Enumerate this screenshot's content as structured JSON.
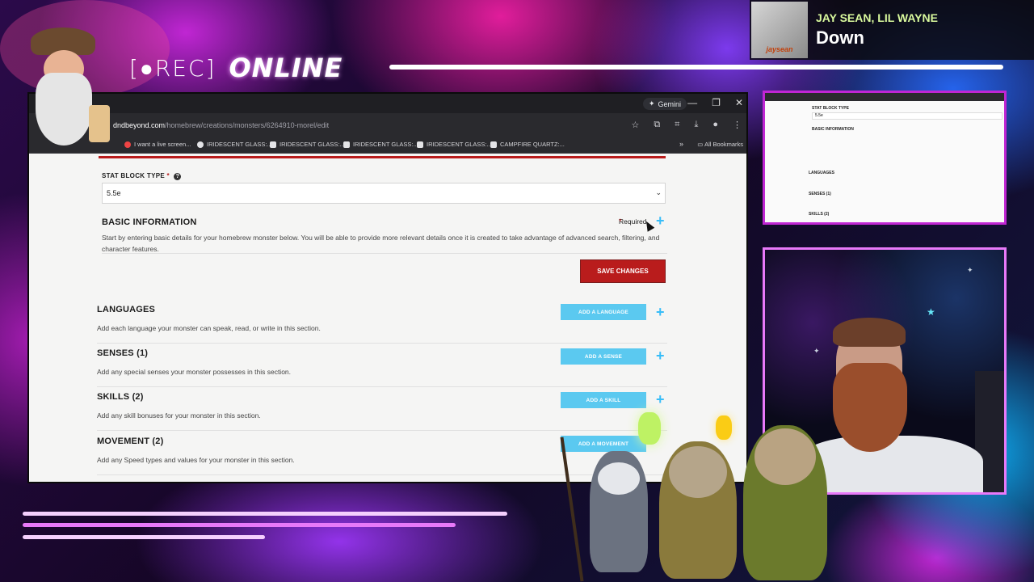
{
  "overlay": {
    "rec_label": "[●REC]",
    "online_label": "ONLINE",
    "colors": {
      "accent_pink": "#e879f9",
      "accent_blue": "#38bdf8"
    }
  },
  "now_playing": {
    "artist": "JAY SEAN, LIL WAYNE",
    "title": "Down",
    "album_text": "jaysean"
  },
  "browser": {
    "gemini_label": "Gemini",
    "url_host": "dndbeyond.com",
    "url_path": "/homebrew/creations/monsters/6264910-morel/edit",
    "bookmarks": [
      "I want a live screen...",
      "IRIDESCENT GLASS:...",
      "IRIDESCENT GLASS:...",
      "IRIDESCENT GLASS:...",
      "IRIDESCENT GLASS:...",
      "CAMPFIRE QUARTZ:..."
    ],
    "all_bookmarks": "All Bookmarks"
  },
  "form": {
    "stat_block_label": "STAT BLOCK TYPE",
    "stat_block_value": "5.5e",
    "basic_title": "BASIC INFORMATION",
    "basic_desc": "Start by entering basic details for your homebrew monster below. You will be able to provide more relevant details once it is created to take advantage of advanced search, filtering, and character features.",
    "required_label": "Required",
    "save_label": "SAVE CHANGES",
    "sections": [
      {
        "title": "LANGUAGES",
        "desc": "Add each language your monster can speak, read, or write in this section.",
        "button": "ADD A LANGUAGE"
      },
      {
        "title": "SENSES (1)",
        "desc": "Add any special senses your monster possesses in this section.",
        "button": "ADD A SENSE"
      },
      {
        "title": "SKILLS (2)",
        "desc": "Add any skill bonuses for your monster in this section.",
        "button": "ADD A SKILL"
      },
      {
        "title": "MOVEMENT (2)",
        "desc": "Add any Speed types and values for your monster in this section.",
        "button": "ADD A MOVEMENT"
      }
    ]
  },
  "preview": {
    "stat_label": "STAT BLOCK TYPE",
    "value": "5.5e",
    "basic_title": "BASIC INFORMATION",
    "languages": "LANGUAGES",
    "senses": "SENSES (1)",
    "skills": "SKILLS (2)"
  }
}
